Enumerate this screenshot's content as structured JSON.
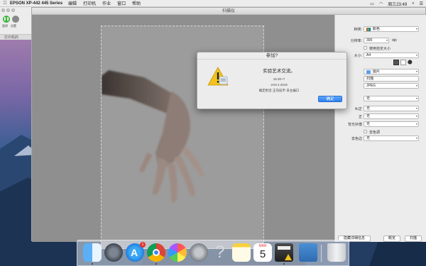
{
  "menubar": {
    "app_name": "EPSON XP-442 445 Series",
    "menus": [
      "编辑",
      "打印机",
      "作业",
      "窗口",
      "帮助"
    ],
    "time": "周三23:49"
  },
  "printer_window": {
    "btn1_label": "暂停",
    "btn2_label": "设置",
    "tab_label": "打印机的"
  },
  "scanner": {
    "title": "扫描仪",
    "settings": {
      "kind_label": "种类:",
      "kind_value": "颜色",
      "resolution_label": "分辨率:",
      "resolution_value": "300",
      "resolution_unit": "dpi",
      "custom_size_label": "使用自定大小",
      "size_label": "大小:",
      "size_value": "A4",
      "scan_to_value": "图片",
      "name_value": "扫描",
      "format_value": "JPEG",
      "opt1_value": "无",
      "opt2_label": "纠正",
      "opt2_value": "无",
      "opt3_label": "正",
      "opt3_value": "无",
      "backlight_label": "背光补偿",
      "backlight_value": "无",
      "descreen_label": "去色调",
      "threshold_label": "去色边",
      "threshold_value": "无"
    },
    "buttons": {
      "hide_details": "隐藏详细信息",
      "overview": "概览",
      "scan": "扫描"
    }
  },
  "alert": {
    "title": "参加?",
    "message": "实验艺术交流。",
    "time": "15:30~?",
    "date": "JAN 4 2019",
    "note": "确定附近 正向投币 日主编口",
    "ok": "确定"
  },
  "dock": {
    "calendar_month": "MAR",
    "calendar_day": "5",
    "badge_count": "1"
  }
}
